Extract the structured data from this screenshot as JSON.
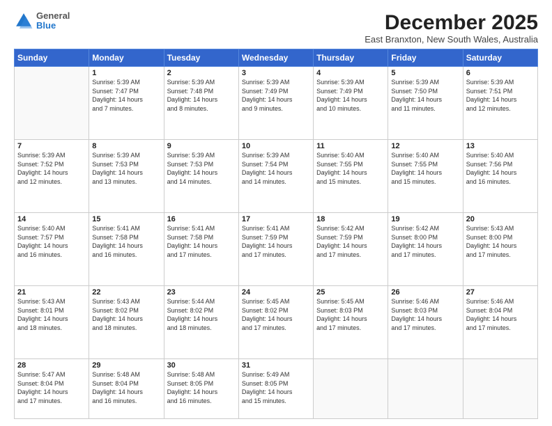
{
  "header": {
    "logo": {
      "general": "General",
      "blue": "Blue"
    },
    "title": "December 2025",
    "location": "East Branxton, New South Wales, Australia"
  },
  "weekdays": [
    "Sunday",
    "Monday",
    "Tuesday",
    "Wednesday",
    "Thursday",
    "Friday",
    "Saturday"
  ],
  "weeks": [
    [
      {
        "day": "",
        "info": ""
      },
      {
        "day": "1",
        "info": "Sunrise: 5:39 AM\nSunset: 7:47 PM\nDaylight: 14 hours\nand 7 minutes."
      },
      {
        "day": "2",
        "info": "Sunrise: 5:39 AM\nSunset: 7:48 PM\nDaylight: 14 hours\nand 8 minutes."
      },
      {
        "day": "3",
        "info": "Sunrise: 5:39 AM\nSunset: 7:49 PM\nDaylight: 14 hours\nand 9 minutes."
      },
      {
        "day": "4",
        "info": "Sunrise: 5:39 AM\nSunset: 7:49 PM\nDaylight: 14 hours\nand 10 minutes."
      },
      {
        "day": "5",
        "info": "Sunrise: 5:39 AM\nSunset: 7:50 PM\nDaylight: 14 hours\nand 11 minutes."
      },
      {
        "day": "6",
        "info": "Sunrise: 5:39 AM\nSunset: 7:51 PM\nDaylight: 14 hours\nand 12 minutes."
      }
    ],
    [
      {
        "day": "7",
        "info": "Sunrise: 5:39 AM\nSunset: 7:52 PM\nDaylight: 14 hours\nand 12 minutes."
      },
      {
        "day": "8",
        "info": "Sunrise: 5:39 AM\nSunset: 7:53 PM\nDaylight: 14 hours\nand 13 minutes."
      },
      {
        "day": "9",
        "info": "Sunrise: 5:39 AM\nSunset: 7:53 PM\nDaylight: 14 hours\nand 14 minutes."
      },
      {
        "day": "10",
        "info": "Sunrise: 5:39 AM\nSunset: 7:54 PM\nDaylight: 14 hours\nand 14 minutes."
      },
      {
        "day": "11",
        "info": "Sunrise: 5:40 AM\nSunset: 7:55 PM\nDaylight: 14 hours\nand 15 minutes."
      },
      {
        "day": "12",
        "info": "Sunrise: 5:40 AM\nSunset: 7:55 PM\nDaylight: 14 hours\nand 15 minutes."
      },
      {
        "day": "13",
        "info": "Sunrise: 5:40 AM\nSunset: 7:56 PM\nDaylight: 14 hours\nand 16 minutes."
      }
    ],
    [
      {
        "day": "14",
        "info": "Sunrise: 5:40 AM\nSunset: 7:57 PM\nDaylight: 14 hours\nand 16 minutes."
      },
      {
        "day": "15",
        "info": "Sunrise: 5:41 AM\nSunset: 7:58 PM\nDaylight: 14 hours\nand 16 minutes."
      },
      {
        "day": "16",
        "info": "Sunrise: 5:41 AM\nSunset: 7:58 PM\nDaylight: 14 hours\nand 17 minutes."
      },
      {
        "day": "17",
        "info": "Sunrise: 5:41 AM\nSunset: 7:59 PM\nDaylight: 14 hours\nand 17 minutes."
      },
      {
        "day": "18",
        "info": "Sunrise: 5:42 AM\nSunset: 7:59 PM\nDaylight: 14 hours\nand 17 minutes."
      },
      {
        "day": "19",
        "info": "Sunrise: 5:42 AM\nSunset: 8:00 PM\nDaylight: 14 hours\nand 17 minutes."
      },
      {
        "day": "20",
        "info": "Sunrise: 5:43 AM\nSunset: 8:00 PM\nDaylight: 14 hours\nand 17 minutes."
      }
    ],
    [
      {
        "day": "21",
        "info": "Sunrise: 5:43 AM\nSunset: 8:01 PM\nDaylight: 14 hours\nand 18 minutes."
      },
      {
        "day": "22",
        "info": "Sunrise: 5:43 AM\nSunset: 8:02 PM\nDaylight: 14 hours\nand 18 minutes."
      },
      {
        "day": "23",
        "info": "Sunrise: 5:44 AM\nSunset: 8:02 PM\nDaylight: 14 hours\nand 18 minutes."
      },
      {
        "day": "24",
        "info": "Sunrise: 5:45 AM\nSunset: 8:02 PM\nDaylight: 14 hours\nand 17 minutes."
      },
      {
        "day": "25",
        "info": "Sunrise: 5:45 AM\nSunset: 8:03 PM\nDaylight: 14 hours\nand 17 minutes."
      },
      {
        "day": "26",
        "info": "Sunrise: 5:46 AM\nSunset: 8:03 PM\nDaylight: 14 hours\nand 17 minutes."
      },
      {
        "day": "27",
        "info": "Sunrise: 5:46 AM\nSunset: 8:04 PM\nDaylight: 14 hours\nand 17 minutes."
      }
    ],
    [
      {
        "day": "28",
        "info": "Sunrise: 5:47 AM\nSunset: 8:04 PM\nDaylight: 14 hours\nand 17 minutes."
      },
      {
        "day": "29",
        "info": "Sunrise: 5:48 AM\nSunset: 8:04 PM\nDaylight: 14 hours\nand 16 minutes."
      },
      {
        "day": "30",
        "info": "Sunrise: 5:48 AM\nSunset: 8:05 PM\nDaylight: 14 hours\nand 16 minutes."
      },
      {
        "day": "31",
        "info": "Sunrise: 5:49 AM\nSunset: 8:05 PM\nDaylight: 14 hours\nand 15 minutes."
      },
      {
        "day": "",
        "info": ""
      },
      {
        "day": "",
        "info": ""
      },
      {
        "day": "",
        "info": ""
      }
    ]
  ]
}
